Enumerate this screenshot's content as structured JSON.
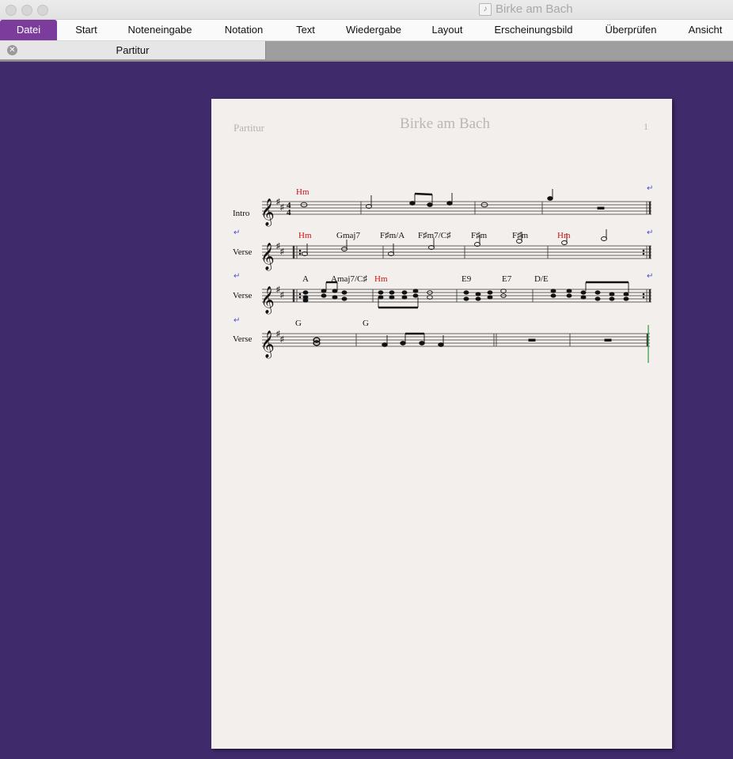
{
  "window": {
    "title": "Birke am Bach"
  },
  "ribbon": {
    "tabs": [
      {
        "label": "Datei",
        "active": true
      },
      {
        "label": "Start"
      },
      {
        "label": "Noteneingabe"
      },
      {
        "label": "Notation"
      },
      {
        "label": "Text"
      },
      {
        "label": "Wiedergabe"
      },
      {
        "label": "Layout"
      },
      {
        "label": "Erscheinungsbild"
      },
      {
        "label": "Überprüfen"
      },
      {
        "label": "Ansicht"
      }
    ]
  },
  "document_tab": {
    "label": "Partitur"
  },
  "score": {
    "header_left": "Partitur",
    "title": "Birke am Bach",
    "page_number": "1",
    "systems": [
      {
        "label": "Intro",
        "chords": [
          {
            "text": "Hm",
            "red": true
          }
        ]
      },
      {
        "label": "Verse",
        "chords": [
          {
            "text": "Hm",
            "red": true
          },
          {
            "text": "Gmaj7"
          },
          {
            "text": "F♯m/A"
          },
          {
            "text": "F♯m7/C♯"
          },
          {
            "text": "F♯m"
          },
          {
            "text": "F♯m"
          },
          {
            "text": "Hm",
            "red": true
          }
        ]
      },
      {
        "label": "Verse",
        "chords": [
          {
            "text": "A"
          },
          {
            "text": "Amaj7/C♯"
          },
          {
            "text": "Hm",
            "red": true
          },
          {
            "text": "E9"
          },
          {
            "text": "E7"
          },
          {
            "text": "D/E"
          }
        ]
      },
      {
        "label": "Verse",
        "chords": [
          {
            "text": "G"
          },
          {
            "text": "G"
          }
        ]
      }
    ]
  },
  "colors": {
    "background": "#3f2a6b",
    "active_tab": "#7b3c9c",
    "chord_red": "#cc1111",
    "page": "#f3efec"
  }
}
